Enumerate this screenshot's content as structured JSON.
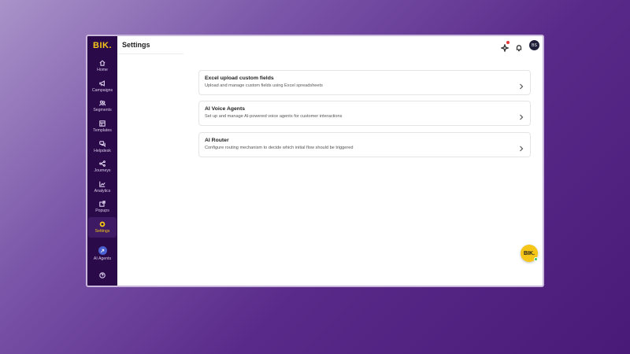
{
  "sidebar": {
    "logo": "BIK.",
    "items": [
      {
        "label": "Home",
        "icon": "home-icon"
      },
      {
        "label": "Campaigns",
        "icon": "megaphone-icon"
      },
      {
        "label": "Segments",
        "icon": "users-icon"
      },
      {
        "label": "Templates",
        "icon": "template-icon"
      },
      {
        "label": "Helpdesk",
        "icon": "chat-icon"
      },
      {
        "label": "Journeys",
        "icon": "journey-icon"
      },
      {
        "label": "Analytics",
        "icon": "chart-icon"
      },
      {
        "label": "Popups",
        "icon": "popup-icon"
      },
      {
        "label": "Settings",
        "icon": "gear-icon"
      }
    ],
    "ai_agents_label": "AI Agents",
    "active": "Settings"
  },
  "header": {
    "title": "Settings",
    "avatar_initials": "BS"
  },
  "cards": [
    {
      "title": "Excel upload custom fields",
      "description": "Upload and manage custom fields using Excel spreadsheets"
    },
    {
      "title": "AI Voice Agents",
      "description": "Set up and manage AI-powered voice agents for customer interactions"
    },
    {
      "title": "AI Router",
      "description": "Configure routing mechanism to decide which initial flow should be triggered"
    }
  ],
  "fab": {
    "label": "BIK."
  },
  "colors": {
    "accent": "#f5c518",
    "sidebar": "#2b0a4a",
    "notification": "#e53935",
    "online": "#34c759"
  }
}
